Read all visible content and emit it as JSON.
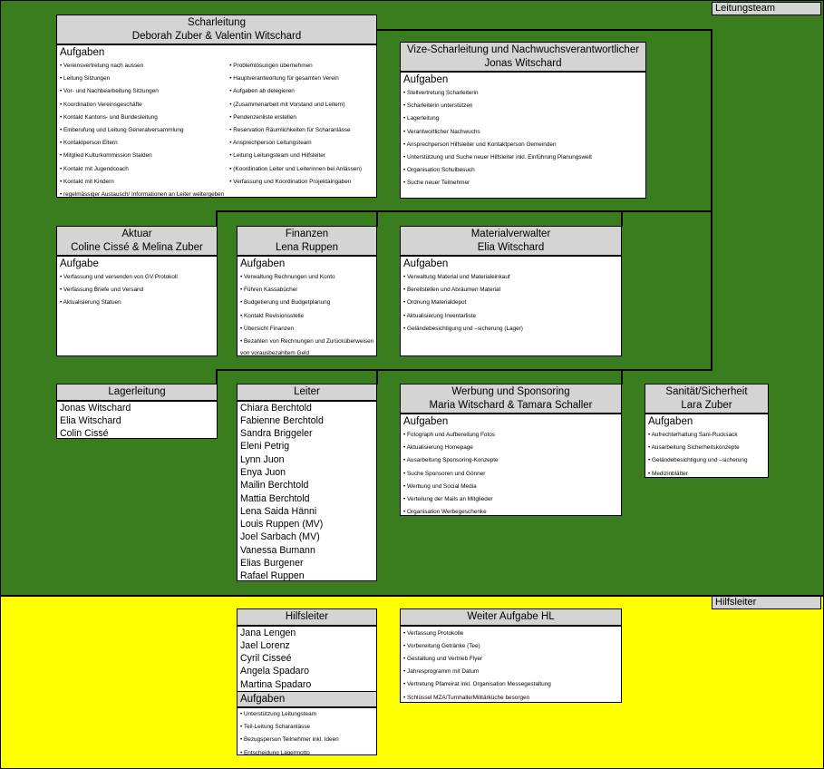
{
  "zones": {
    "leitungsteam": "Leitungsteam",
    "hilfsleiter": "Hilfsleiter"
  },
  "scharleitung": {
    "title": "Scharleitung",
    "names": "Deborah Zuber & Valentin Witschard",
    "tasks_label": "Aufgaben",
    "tasks_left": [
      "Vereinsvertretung nach aussen",
      "Leitung Sitzungen",
      "Vor- und Nachbearbeitung Sitzungen",
      "Koordination Vereinsgeschäfte",
      "Kontakt Kantons- und Bundesleitung",
      "Einberufung und Leitung Generalversammlung",
      "Kontaktperson Eltern",
      "Mitglied Kulturkommission Stalden",
      "Kontakt mit Jugendcoach",
      "Kontakt mit Kindern",
      "regelmässiger Austausch/ Informationen an Leiter weitergeben"
    ],
    "tasks_right": [
      "Problemlösungen übernehmen",
      "Hauptverantwortung für gesamten Verein",
      "Aufgaben ab delegieren",
      "(Zusammenarbeit mit Vorstand und Leitern)",
      "Pendenzenliste erstellen",
      "Reservation Räumlichkeiten für Scharanlässe",
      "Ansprechperson Leitungsteam",
      "Leitung Leitungsteam und Hilfsleiter",
      "(Koordination Leiter und Leiterinnen bei Anlässen)",
      "Verfassung und Koordination Projektaingaben"
    ]
  },
  "vize": {
    "title": "Vize-Scharleitung und Nachwuchsverantwortlicher",
    "names": "Jonas Witschard",
    "tasks_label": "Aufgaben",
    "tasks": [
      "Stellvertretung Scharleiterin",
      "Scharleiterin unterstützen",
      "Lagerleitung",
      "Verantwortlicher Nachwuchs",
      "Ansprechperson Hilfsleiter und Kontaktperson Gemeinden",
      "Unterstützung und Suche neuer Hilfsleiter inkl. Einführung Planungswelt",
      "Organisation Schulbesuch",
      "Suche neuer Teilnehmer"
    ]
  },
  "aktuar": {
    "title": "Aktuar",
    "names": "Coline Cissé & Melina Zuber",
    "tasks_label": "Aufgabe",
    "tasks": [
      "Verfassung und versenden von GV Protokoll",
      "Verfassung Briefe und Versand",
      "Aktualisierung Statuen"
    ]
  },
  "finanzen": {
    "title": "Finanzen",
    "names": "Lena Ruppen",
    "tasks_label": "Aufgaben",
    "tasks": [
      "Verwaltung Rechnungen und Konto",
      "Führen Kassabücher",
      "Budgetierung und Budgetplanung",
      "Kontakt Revisionsstelle",
      "Übersicht Finanzen",
      "Bezahlen von Rechnungen und Zurücküberweisen"
    ],
    "tasks_tail": "von vorausbezahltem Geld"
  },
  "material": {
    "title": "Materialverwalter",
    "names": "Elia Witschard",
    "tasks_label": "Aufgaben",
    "tasks": [
      "Verwaltung Material und Materialeinkauf",
      "Bereitstellen und Abräumen Material",
      "Ordnung Materialdepot",
      "Aktualisierung Inventarliste",
      "Geländebesichtigung und –sicherung (Lager)"
    ]
  },
  "lagerleitung": {
    "title": "Lagerleitung",
    "members": [
      "Jonas Witschard",
      "Elia Witschard",
      "Colin Cissé"
    ]
  },
  "leiter": {
    "title": "Leiter",
    "members": [
      "Chiara Berchtold",
      "Fabienne Berchtold",
      "Sandra Briggeler",
      "Eleni Petrig",
      "Lynn Juon",
      "Enya Juon",
      "Mailin Berchtold",
      "Mattia Berchtold",
      "Lena Saida Hänni",
      "Louis Ruppen (MV)",
      "Joel Sarbach (MV)",
      "Vanessa Bumann",
      "Elias Burgener",
      "Rafael Ruppen"
    ]
  },
  "werbung": {
    "title": "Werbung und Sponsoring",
    "names": "Maria Witschard & Tamara Schaller",
    "tasks_label": "Aufgaben",
    "tasks": [
      "Fotograph und Aufbereitung Fotos",
      "Aktualisierung Homepage",
      "Ausarbeitung Sponsoring-Konzepte",
      "Suche Sponsoren und Gönner",
      "Werbung und Social Media",
      "Verteilung der Mails an Mitglieder",
      "Organisation Werbegeschenke"
    ]
  },
  "sanitaet": {
    "title": "Sanität/Sicherheit",
    "names": "Lara Zuber",
    "tasks_label": "Aufgaben",
    "tasks": [
      "Aufrechterhaltung Sani-Rucksack",
      "Ausarbeitung Sicherheitskonzepte",
      "Geländebesichtigung und –sicherung",
      "Medizinblätter"
    ]
  },
  "hilfsleiter": {
    "title": "Hilfsleiter",
    "members": [
      "Jana Lengen",
      "Jael Lorenz",
      "Cyril Cisseé",
      "Angela Spadaro",
      "Martina Spadaro"
    ],
    "tasks_label": "Aufgaben",
    "tasks": [
      "Unterstützung Leitungsteam",
      "Teil-Leitung Scharanlässe",
      "Bezugsperson Teilnehmer inkl. Ideen",
      "Entscheidung Lagermotto"
    ]
  },
  "weitere": {
    "title": "Weiter Aufgabe HL",
    "tasks": [
      "Verfassung Protokolle",
      "Vorbereitung Getränke (Tee)",
      "Gestaltung und Vertrieb Flyer",
      "Jahresprogramm mit Datum",
      "Vertretung Pfarreirat inkl. Organisation Messegestaltung",
      "Schlüssel MZA/Turnhalle/Militärküche besorgen"
    ]
  },
  "colors": {
    "leitungsteam_bg": "#3a7d1f",
    "hilfsleiter_bg": "#ffff00",
    "header_bg": "#d4d4d4"
  }
}
